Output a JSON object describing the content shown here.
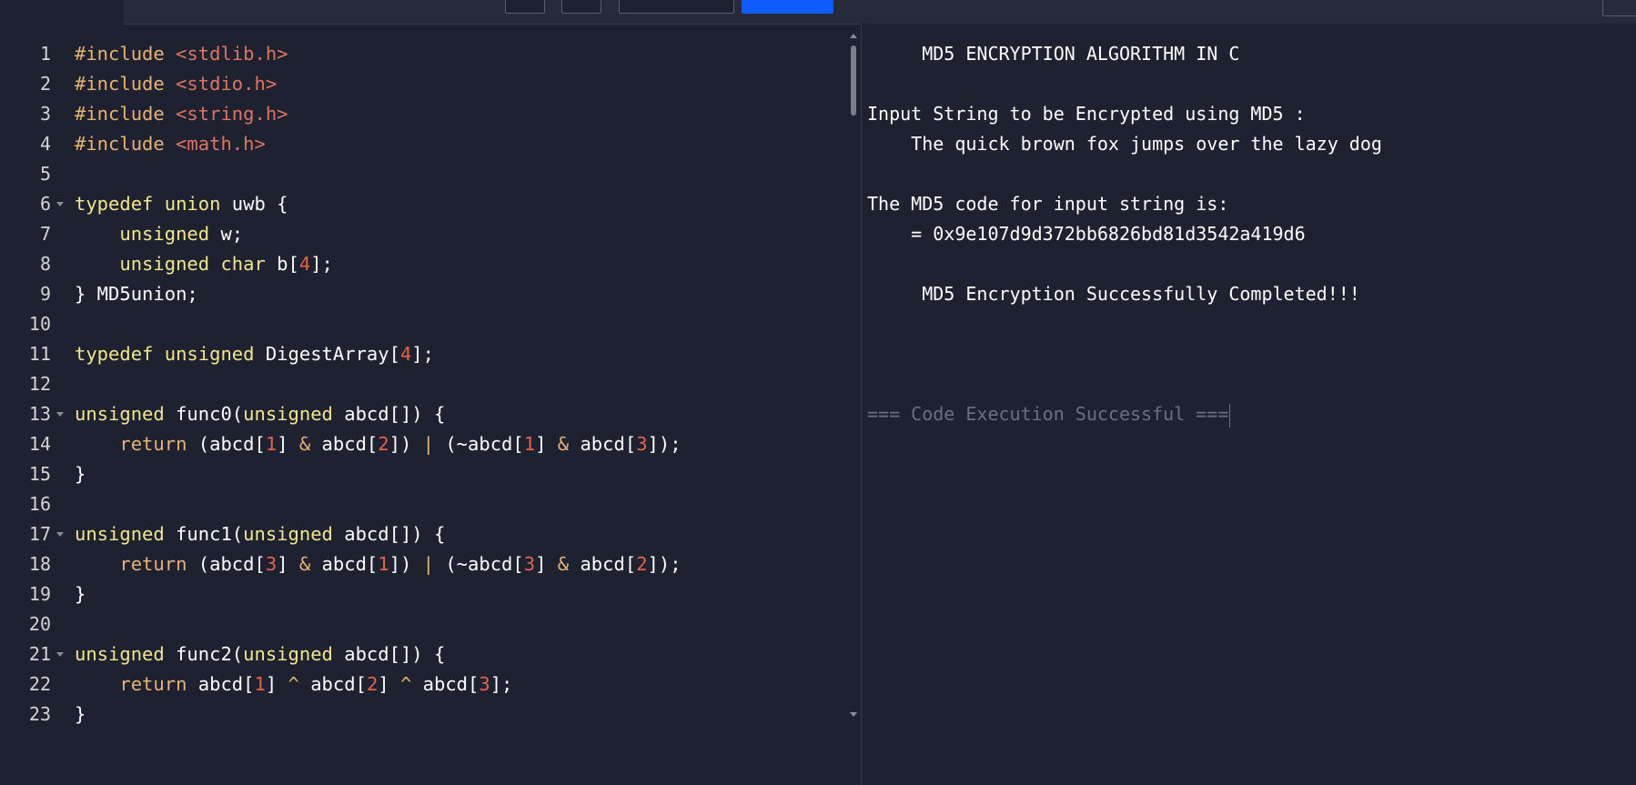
{
  "editor": {
    "line_numbers": [
      "1",
      "2",
      "3",
      "4",
      "5",
      "6",
      "7",
      "8",
      "9",
      "10",
      "11",
      "12",
      "13",
      "14",
      "15",
      "16",
      "17",
      "18",
      "19",
      "20",
      "21",
      "22",
      "23"
    ],
    "foldable_lines": [
      6,
      13,
      17,
      21
    ]
  },
  "code": {
    "l1_directive": "#include",
    "l1_header": "<stdlib.h>",
    "l2_directive": "#include",
    "l2_header": "<stdio.h>",
    "l3_directive": "#include",
    "l3_header": "<string.h>",
    "l4_directive": "#include",
    "l4_header": "<math.h>",
    "l6_kw1": "typedef",
    "l6_kw2": "union",
    "l6_rest": " uwb {",
    "l7_kw": "unsigned",
    "l7_rest": " w;",
    "l8_kw1": "unsigned",
    "l8_kw2": "char",
    "l8_a": " b[",
    "l8_n": "4",
    "l8_b": "];",
    "l9": "} MD5union;",
    "l11_kw1": "typedef",
    "l11_kw2": "unsigned",
    "l11_a": " DigestArray[",
    "l11_n": "4",
    "l11_b": "];",
    "l13_kw1": "unsigned",
    "l13_a": " func0(",
    "l13_kw2": "unsigned",
    "l13_b": " abcd[]) {",
    "l14_ret": "return",
    "l14_a": " (abcd[",
    "l14_n1": "1",
    "l14_b": "] ",
    "l14_op1": "&",
    "l14_c": " abcd[",
    "l14_n2": "2",
    "l14_d": "]) ",
    "l14_op2": "|",
    "l14_e": " (~abcd[",
    "l14_n3": "1",
    "l14_f": "] ",
    "l14_op3": "&",
    "l14_g": " abcd[",
    "l14_n4": "3",
    "l14_h": "]);",
    "l15": "}",
    "l17_kw1": "unsigned",
    "l17_a": " func1(",
    "l17_kw2": "unsigned",
    "l17_b": " abcd[]) {",
    "l18_ret": "return",
    "l18_a": " (abcd[",
    "l18_n1": "3",
    "l18_b": "] ",
    "l18_op1": "&",
    "l18_c": " abcd[",
    "l18_n2": "1",
    "l18_d": "]) ",
    "l18_op2": "|",
    "l18_e": " (~abcd[",
    "l18_n3": "3",
    "l18_f": "] ",
    "l18_op3": "&",
    "l18_g": " abcd[",
    "l18_n4": "2",
    "l18_h": "]);",
    "l19": "}",
    "l21_kw1": "unsigned",
    "l21_a": " func2(",
    "l21_kw2": "unsigned",
    "l21_b": " abcd[]) {",
    "l22_ret": "return",
    "l22_a": " abcd[",
    "l22_n1": "1",
    "l22_b": "] ",
    "l22_op1": "^",
    "l22_c": " abcd[",
    "l22_n2": "2",
    "l22_d": "] ",
    "l22_op2": "^",
    "l22_e": " abcd[",
    "l22_n3": "3",
    "l22_f": "];",
    "l23": "}"
  },
  "output": {
    "title": "     MD5 ENCRYPTION ALGORITHM IN C",
    "input_label": "Input String to be Encrypted using MD5 :",
    "input_value": "    The quick brown fox jumps over the lazy dog",
    "result_label": "The MD5 code for input string is:",
    "result_value": "    = 0x9e107d9d372bb6826bd81d3542a419d6",
    "success_msg": "     MD5 Encryption Successfully Completed!!!",
    "exec_status": "=== Code Execution Successful ==="
  },
  "colors": {
    "background": "#1d2130",
    "keyword": "#f4e68c",
    "preprocessor": "#e8b373",
    "include_header": "#e0745f",
    "number": "#e8624b",
    "run_button": "#0d5cff"
  }
}
